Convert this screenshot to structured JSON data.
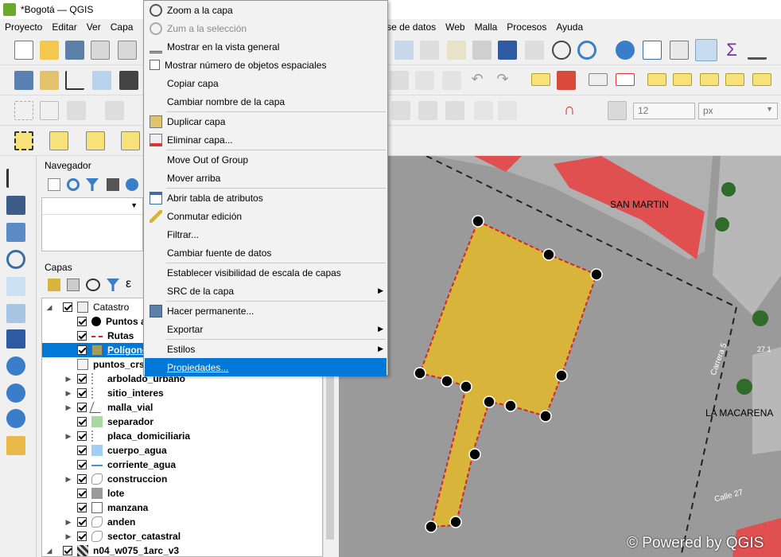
{
  "window": {
    "title": "*Bogotá — QGIS"
  },
  "menubar": {
    "left": [
      "Proyecto",
      "Editar",
      "Ver",
      "Capa"
    ],
    "right": [
      "ase de datos",
      "Web",
      "Malla",
      "Procesos",
      "Ayuda"
    ]
  },
  "toolbar": {
    "font_size_value": "12",
    "unit_value": "px"
  },
  "nav_panel": {
    "title": "Navegador"
  },
  "layers_panel": {
    "title": "Capas",
    "items": [
      {
        "label": "Catastro"
      },
      {
        "label": "Puntos a"
      },
      {
        "label": "Rutas"
      },
      {
        "label": "Polígono"
      },
      {
        "label": "puntos_crs_"
      },
      {
        "label": "arbolado_urbano"
      },
      {
        "label": "sitio_interes"
      },
      {
        "label": "malla_vial"
      },
      {
        "label": "separador"
      },
      {
        "label": "placa_domiciliaria"
      },
      {
        "label": "cuerpo_agua"
      },
      {
        "label": "corriente_agua"
      },
      {
        "label": "construccion"
      },
      {
        "label": "lote"
      },
      {
        "label": "manzana"
      },
      {
        "label": "anden"
      },
      {
        "label": "sector_catastral"
      },
      {
        "label": "n04_w075_1arc_v3"
      }
    ]
  },
  "context_menu": {
    "items": [
      {
        "label": "Zoom a la capa"
      },
      {
        "label": "Zum a la selección"
      },
      {
        "label": "Mostrar en la vista general"
      },
      {
        "label": "Mostrar número de objetos espaciales"
      },
      {
        "label": "Copiar capa"
      },
      {
        "label": "Cambiar nombre de la capa"
      },
      {
        "label": "Duplicar capa"
      },
      {
        "label": "Eliminar capa..."
      },
      {
        "label": "Move Out of Group"
      },
      {
        "label": "Mover arriba"
      },
      {
        "label": "Abrir tabla de atributos"
      },
      {
        "label": "Conmutar edición"
      },
      {
        "label": "Filtrar..."
      },
      {
        "label": "Cambiar fuente de datos"
      },
      {
        "label": "Establecer visibilidad de escala de capas"
      },
      {
        "label": "SRC de la capa"
      },
      {
        "label": "Hacer permanente..."
      },
      {
        "label": "Exportar"
      },
      {
        "label": "Estilos"
      },
      {
        "label": "Propiedades..."
      }
    ]
  },
  "map": {
    "labels": {
      "san_martin": "SAN MARTIN",
      "la_macarena": "LA MACARENA",
      "carrera": "Carrera 5",
      "calle": "Calle 27",
      "num": "27 1"
    },
    "watermark": "© Powered by QGIS"
  },
  "colors": {
    "accent": "#0078d7",
    "polygon_fill": "#d9b43b",
    "building": "#e05050",
    "map_bg": "#9a9a9a"
  }
}
